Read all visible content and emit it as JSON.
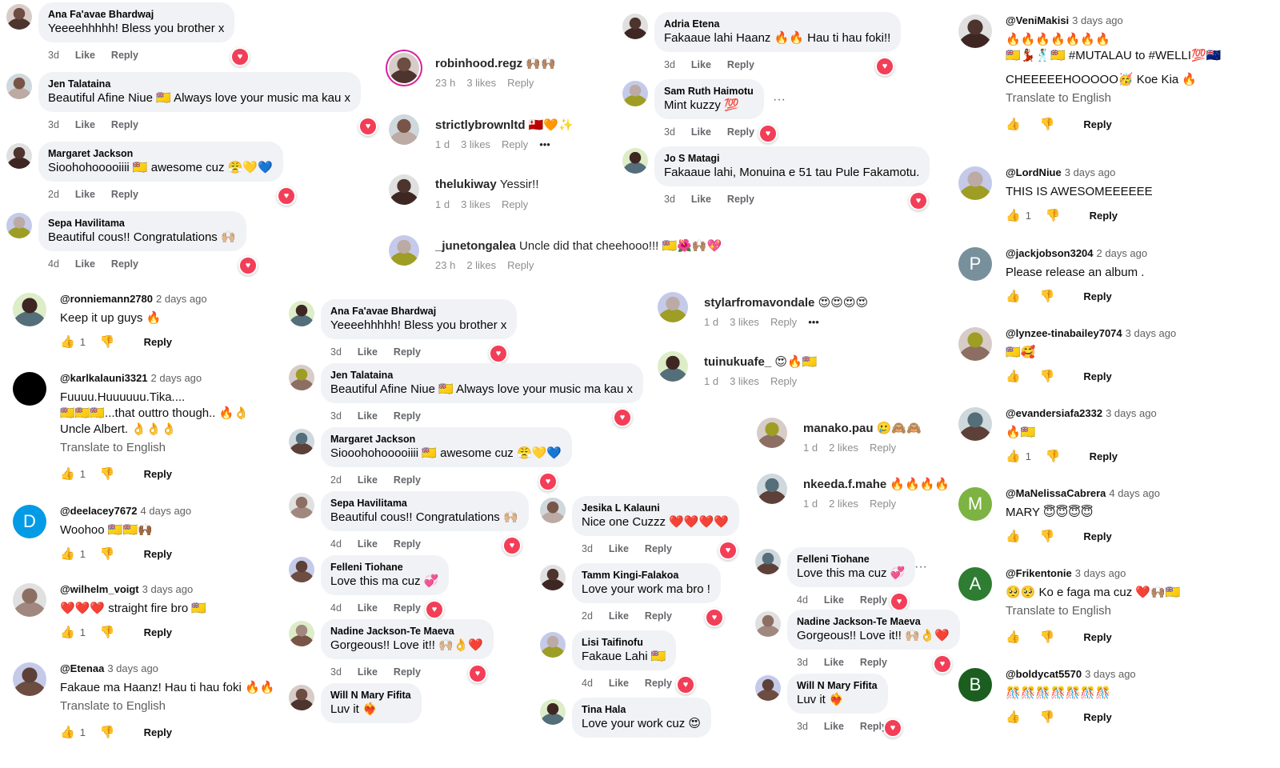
{
  "fb_col1": [
    {
      "name": "Ana Fa'avae Bhardwaj",
      "text": "Yeeeehhhhh! Bless you brother x",
      "time": "3d"
    },
    {
      "name": "Jen Talataina",
      "text": "Beautiful Afine Niue 🇳🇺 Always love your music ma kau x",
      "time": "3d"
    },
    {
      "name": "Margaret Jackson",
      "text": "Sioohohooooiiii 🇳🇺 awesome cuz 😤💛💙",
      "time": "2d"
    },
    {
      "name": "Sepa Havilitama",
      "text": "Beautiful cous!! Congratulations 🙌🏼",
      "time": "4d"
    }
  ],
  "fb_labels": {
    "like": "Like",
    "reply": "Reply"
  },
  "ig_col": [
    {
      "name": "robinhood.regz",
      "text": "🙌🏽🙌🏽",
      "time": "23 h",
      "likes": "3 likes"
    },
    {
      "name": "strictlybrownltd",
      "text": "🇹🇴🧡✨",
      "time": "1 d",
      "likes": "3 likes"
    },
    {
      "name": "thelukiway",
      "text": "Yessir!!",
      "time": "1 d",
      "likes": "3 likes"
    },
    {
      "name": "_junetongalea",
      "text": "Uncle did that cheehooo!!! 🇳🇺🌺🙌🏽💖",
      "time": "23 h",
      "likes": "2 likes"
    }
  ],
  "ig_labels": {
    "reply": "Reply"
  },
  "fb_col3": [
    {
      "name": "Adria Etena",
      "text": "Fakaaue lahi Haanz 🔥🔥 Hau ti hau foki!!",
      "time": "3d"
    },
    {
      "name": "Sam Ruth Haimotu",
      "text": "Mint kuzzy 💯",
      "time": "3d"
    },
    {
      "name": "Jo S Matagi",
      "text": "Fakaaue lahi, Monuina e 51 tau Pule Fakamotu.",
      "time": "3d"
    }
  ],
  "yt_right": [
    {
      "handle": "@VeniMakisi",
      "date": "3 days ago",
      "lines": [
        "🔥🔥🔥🔥🔥🔥🔥",
        "🇳🇺💃🏽🕺🏽🇳🇺 #MUTALAU to #WELLI💯🇳🇿"
      ],
      "extra": "CHEEEEEHOOOOO🥳 Koe Kia 🔥",
      "translate": "Translate to English",
      "count": ""
    },
    {
      "handle": "@LordNiue",
      "date": "3 days ago",
      "lines": [
        "THIS IS AWESOMEEEEEE"
      ],
      "count": "1"
    },
    {
      "handle": "@jackjobson3204",
      "date": "2 days ago",
      "lines": [
        "Please release an album ."
      ],
      "count": "",
      "initial": "P"
    },
    {
      "handle": "@lynzee-tinabailey7074",
      "date": "3 days ago",
      "lines": [
        "🇳🇺🥰"
      ],
      "count": ""
    },
    {
      "handle": "@evandersiafa2332",
      "date": "3 days ago",
      "lines": [
        "🔥🇳🇺"
      ],
      "count": "1"
    },
    {
      "handle": "@MaNelissaCabrera",
      "date": "4 days ago",
      "lines": [
        "MARY 😇😇😇😇"
      ],
      "count": "",
      "initial": "M"
    },
    {
      "handle": "@Frikentonie",
      "date": "3 days ago",
      "lines": [
        "🥺🥺 Ko e faga ma cuz ❤️🙌🏽🇳🇺"
      ],
      "translate": "Translate to English",
      "count": "",
      "initial": "A"
    },
    {
      "handle": "@boldycat5570",
      "date": "3 days ago",
      "lines": [
        "🎊🎊🎊🎊🎊🎊🎊"
      ],
      "count": "",
      "initial": "B"
    }
  ],
  "yt_left": [
    {
      "handle": "@ronniemann2780",
      "date": "2 days ago",
      "lines": [
        "Keep it up guys 🔥"
      ],
      "count": "1"
    },
    {
      "handle": "@karlkalauni3321",
      "date": "2 days ago",
      "lines": [
        "Fuuuu.Huuuuuu.Tika....",
        "🇳🇺🇳🇺🇳🇺...that outtro though.. 🔥👌",
        "Uncle Albert. 👌👌👌"
      ],
      "translate": "Translate to English",
      "count": "1"
    },
    {
      "handle": "@deelacey7672",
      "date": "4 days ago",
      "lines": [
        "Woohoo 🇳🇺🇳🇺🙌🏾"
      ],
      "count": "1",
      "initial": "D"
    },
    {
      "handle": "@wilhelm_voigt",
      "date": "3 days ago",
      "lines": [
        "❤️❤️❤️ straight fire bro 🇳🇺"
      ],
      "count": "1"
    },
    {
      "handle": "@Etenaa",
      "date": "3 days ago",
      "lines": [
        "Fakaue ma Haanz! Hau ti hau foki 🔥🔥"
      ],
      "translate": "Translate to English",
      "count": "1"
    }
  ],
  "yt_labels": {
    "reply": "Reply"
  },
  "fb_mid": [
    {
      "name": "Ana Fa'avae Bhardwaj",
      "text": "Yeeeehhhhh! Bless you brother x",
      "time": "3d"
    },
    {
      "name": "Jen Talataina",
      "text": "Beautiful Afine Niue 🇳🇺 Always love your music ma kau x",
      "time": "3d"
    },
    {
      "name": "Margaret Jackson",
      "text": "Siooohohooooiiii 🇳🇺 awesome cuz 😤💛💙",
      "time": "2d"
    },
    {
      "name": "Sepa Havilitama",
      "text": "Beautiful cous!! Congratulations 🙌🏼",
      "time": "4d"
    },
    {
      "name": "Felleni Tiohane",
      "text": "Love this ma cuz 💞",
      "time": "4d"
    },
    {
      "name": "Nadine Jackson-Te Maeva",
      "text": "Gorgeous!! Love it!! 🙌🏼👌❤️",
      "time": "3d"
    },
    {
      "name": "Will N Mary Fifita",
      "text": "Luv it ❤️‍🔥",
      "time": ""
    }
  ],
  "ig_mid": [
    {
      "name": "stylarfromavondale",
      "text": "😍😍😍😍",
      "time": "1 d",
      "likes": "3 likes"
    },
    {
      "name": "tuinukuafe_",
      "text": "😍🔥🇳🇺",
      "time": "1 d",
      "likes": "3 likes"
    }
  ],
  "ig_mid2": [
    {
      "name": "manako.pau",
      "text": "🥲🙈🙈",
      "time": "1 d",
      "likes": "2 likes"
    },
    {
      "name": "nkeeda.f.mahe",
      "text": "🔥🔥🔥🔥",
      "time": "1 d",
      "likes": "2 likes"
    }
  ],
  "fb_c3": [
    {
      "name": "Jesika L Kalauni",
      "text": "Nice one Cuzzz ❤️❤️❤️❤️",
      "time": "3d"
    },
    {
      "name": "Tamm Kingi-Falakoa",
      "text": "Love your work ma bro !",
      "time": "2d"
    },
    {
      "name": "Lisi Taifinofu",
      "text": "Fakaue Lahi 🇳🇺",
      "time": "4d"
    },
    {
      "name": "Tina Hala",
      "text": "Love your work cuz 😍",
      "time": ""
    }
  ],
  "fb_c4": [
    {
      "name": "Felleni Tiohane",
      "text": "Love this ma cuz 💞",
      "time": "4d"
    },
    {
      "name": "Nadine Jackson-Te Maeva",
      "text": "Gorgeous!! Love it!! 🙌🏼👌❤️",
      "time": "3d"
    },
    {
      "name": "Will N Mary Fifita",
      "text": "Luv it ❤️‍🔥",
      "time": "3d"
    }
  ],
  "colors": {
    "heart": "#f33e58",
    "bubble": "#f0f2f5",
    "yt_link": "#065fd4"
  }
}
